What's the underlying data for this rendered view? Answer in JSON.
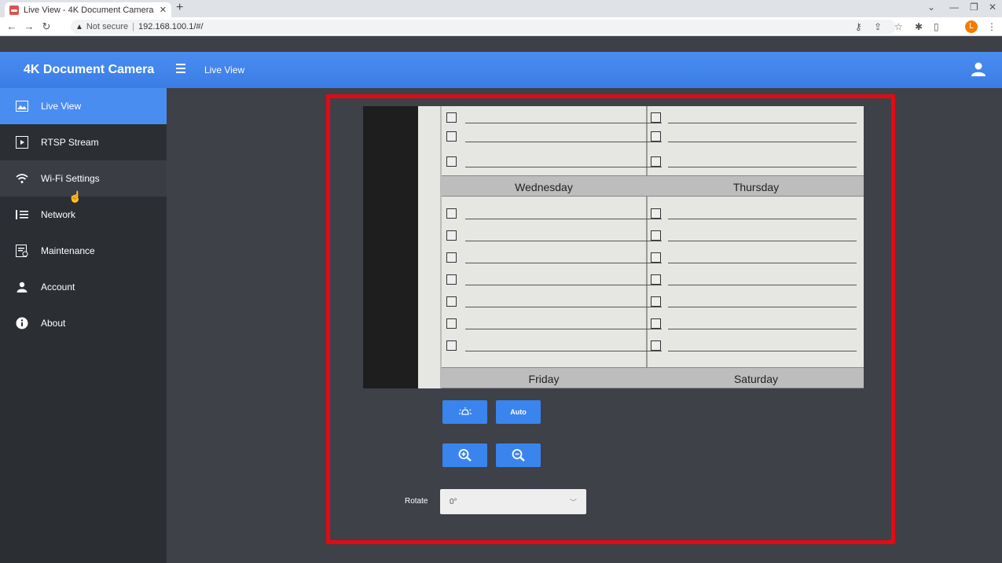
{
  "browser": {
    "tab_title": "Live View - 4K Document Camera",
    "new_tab": "+",
    "not_secure": "Not secure",
    "url": "192.168.100.1/#/",
    "profile_initial": "L"
  },
  "app": {
    "brand": "4K Document Camera",
    "header_title": "Live View"
  },
  "sidebar": {
    "items": [
      {
        "label": "Live View",
        "icon": "image-icon"
      },
      {
        "label": "RTSP Stream",
        "icon": "play-icon"
      },
      {
        "label": "Wi-Fi Settings",
        "icon": "wifi-icon"
      },
      {
        "label": "Network",
        "icon": "list-icon"
      },
      {
        "label": "Maintenance",
        "icon": "maintenance-icon"
      },
      {
        "label": "Account",
        "icon": "user-icon"
      },
      {
        "label": "About",
        "icon": "info-icon"
      }
    ]
  },
  "preview": {
    "labels": {
      "wednesday": "Wednesday",
      "thursday": "Thursday",
      "friday": "Friday",
      "saturday": "Saturday"
    }
  },
  "controls": {
    "auto_label": "Auto",
    "rotate_label": "Rotate",
    "rotate_value": "0°"
  },
  "colors": {
    "accent": "#3b7de6",
    "sidebar_bg": "#2b2e33",
    "highlight": "#e50914"
  }
}
